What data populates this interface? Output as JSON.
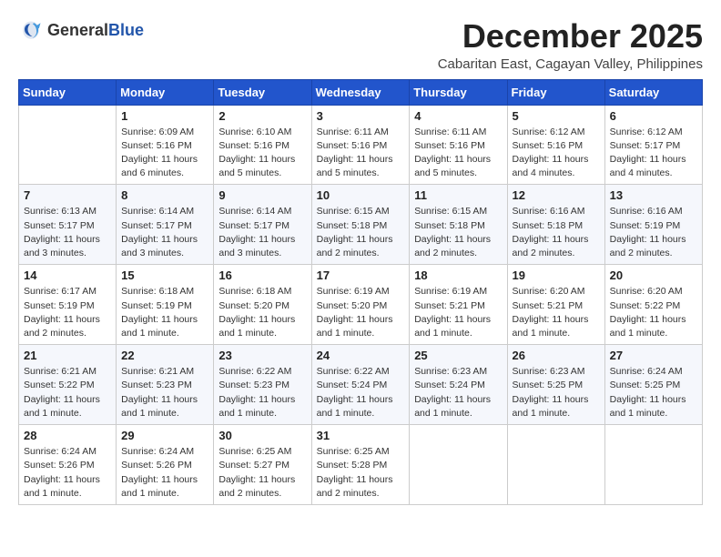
{
  "header": {
    "logo_general": "General",
    "logo_blue": "Blue",
    "month_title": "December 2025",
    "location": "Cabaritan East, Cagayan Valley, Philippines"
  },
  "columns": [
    "Sunday",
    "Monday",
    "Tuesday",
    "Wednesday",
    "Thursday",
    "Friday",
    "Saturday"
  ],
  "weeks": [
    [
      {
        "day": "",
        "info": ""
      },
      {
        "day": "1",
        "info": "Sunrise: 6:09 AM\nSunset: 5:16 PM\nDaylight: 11 hours\nand 6 minutes."
      },
      {
        "day": "2",
        "info": "Sunrise: 6:10 AM\nSunset: 5:16 PM\nDaylight: 11 hours\nand 5 minutes."
      },
      {
        "day": "3",
        "info": "Sunrise: 6:11 AM\nSunset: 5:16 PM\nDaylight: 11 hours\nand 5 minutes."
      },
      {
        "day": "4",
        "info": "Sunrise: 6:11 AM\nSunset: 5:16 PM\nDaylight: 11 hours\nand 5 minutes."
      },
      {
        "day": "5",
        "info": "Sunrise: 6:12 AM\nSunset: 5:16 PM\nDaylight: 11 hours\nand 4 minutes."
      },
      {
        "day": "6",
        "info": "Sunrise: 6:12 AM\nSunset: 5:17 PM\nDaylight: 11 hours\nand 4 minutes."
      }
    ],
    [
      {
        "day": "7",
        "info": "Sunrise: 6:13 AM\nSunset: 5:17 PM\nDaylight: 11 hours\nand 3 minutes."
      },
      {
        "day": "8",
        "info": "Sunrise: 6:14 AM\nSunset: 5:17 PM\nDaylight: 11 hours\nand 3 minutes."
      },
      {
        "day": "9",
        "info": "Sunrise: 6:14 AM\nSunset: 5:17 PM\nDaylight: 11 hours\nand 3 minutes."
      },
      {
        "day": "10",
        "info": "Sunrise: 6:15 AM\nSunset: 5:18 PM\nDaylight: 11 hours\nand 2 minutes."
      },
      {
        "day": "11",
        "info": "Sunrise: 6:15 AM\nSunset: 5:18 PM\nDaylight: 11 hours\nand 2 minutes."
      },
      {
        "day": "12",
        "info": "Sunrise: 6:16 AM\nSunset: 5:18 PM\nDaylight: 11 hours\nand 2 minutes."
      },
      {
        "day": "13",
        "info": "Sunrise: 6:16 AM\nSunset: 5:19 PM\nDaylight: 11 hours\nand 2 minutes."
      }
    ],
    [
      {
        "day": "14",
        "info": "Sunrise: 6:17 AM\nSunset: 5:19 PM\nDaylight: 11 hours\nand 2 minutes."
      },
      {
        "day": "15",
        "info": "Sunrise: 6:18 AM\nSunset: 5:19 PM\nDaylight: 11 hours\nand 1 minute."
      },
      {
        "day": "16",
        "info": "Sunrise: 6:18 AM\nSunset: 5:20 PM\nDaylight: 11 hours\nand 1 minute."
      },
      {
        "day": "17",
        "info": "Sunrise: 6:19 AM\nSunset: 5:20 PM\nDaylight: 11 hours\nand 1 minute."
      },
      {
        "day": "18",
        "info": "Sunrise: 6:19 AM\nSunset: 5:21 PM\nDaylight: 11 hours\nand 1 minute."
      },
      {
        "day": "19",
        "info": "Sunrise: 6:20 AM\nSunset: 5:21 PM\nDaylight: 11 hours\nand 1 minute."
      },
      {
        "day": "20",
        "info": "Sunrise: 6:20 AM\nSunset: 5:22 PM\nDaylight: 11 hours\nand 1 minute."
      }
    ],
    [
      {
        "day": "21",
        "info": "Sunrise: 6:21 AM\nSunset: 5:22 PM\nDaylight: 11 hours\nand 1 minute."
      },
      {
        "day": "22",
        "info": "Sunrise: 6:21 AM\nSunset: 5:23 PM\nDaylight: 11 hours\nand 1 minute."
      },
      {
        "day": "23",
        "info": "Sunrise: 6:22 AM\nSunset: 5:23 PM\nDaylight: 11 hours\nand 1 minute."
      },
      {
        "day": "24",
        "info": "Sunrise: 6:22 AM\nSunset: 5:24 PM\nDaylight: 11 hours\nand 1 minute."
      },
      {
        "day": "25",
        "info": "Sunrise: 6:23 AM\nSunset: 5:24 PM\nDaylight: 11 hours\nand 1 minute."
      },
      {
        "day": "26",
        "info": "Sunrise: 6:23 AM\nSunset: 5:25 PM\nDaylight: 11 hours\nand 1 minute."
      },
      {
        "day": "27",
        "info": "Sunrise: 6:24 AM\nSunset: 5:25 PM\nDaylight: 11 hours\nand 1 minute."
      }
    ],
    [
      {
        "day": "28",
        "info": "Sunrise: 6:24 AM\nSunset: 5:26 PM\nDaylight: 11 hours\nand 1 minute."
      },
      {
        "day": "29",
        "info": "Sunrise: 6:24 AM\nSunset: 5:26 PM\nDaylight: 11 hours\nand 1 minute."
      },
      {
        "day": "30",
        "info": "Sunrise: 6:25 AM\nSunset: 5:27 PM\nDaylight: 11 hours\nand 2 minutes."
      },
      {
        "day": "31",
        "info": "Sunrise: 6:25 AM\nSunset: 5:28 PM\nDaylight: 11 hours\nand 2 minutes."
      },
      {
        "day": "",
        "info": ""
      },
      {
        "day": "",
        "info": ""
      },
      {
        "day": "",
        "info": ""
      }
    ]
  ]
}
